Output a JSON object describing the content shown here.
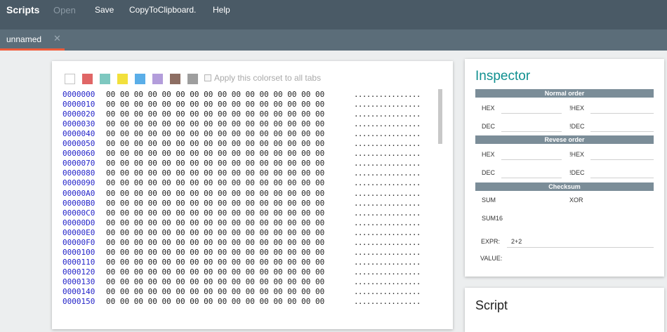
{
  "topbar": {
    "brand": "Scripts",
    "menu": {
      "open": "Open",
      "save": "Save",
      "copy": "CopyToClipboard.",
      "help": "Help"
    }
  },
  "tabs": [
    {
      "label": "unnamed",
      "close_glyph": "✕"
    }
  ],
  "colorset": {
    "swatches": [
      "#ffffff",
      "#e06666",
      "#7ec8c0",
      "#f2e03c",
      "#5aaee8",
      "#b39ddb",
      "#8d6e63",
      "#9e9e9e"
    ],
    "apply_label": "Apply this colorset to all tabs",
    "apply_checked": false
  },
  "hex": {
    "rows": [
      {
        "addr": "0000000",
        "bytes": "00 00 00 00 00 00 00 00 00 00 00 00 00 00 00 00",
        "ascii": "................"
      },
      {
        "addr": "0000010",
        "bytes": "00 00 00 00 00 00 00 00 00 00 00 00 00 00 00 00",
        "ascii": "................"
      },
      {
        "addr": "0000020",
        "bytes": "00 00 00 00 00 00 00 00 00 00 00 00 00 00 00 00",
        "ascii": "................"
      },
      {
        "addr": "0000030",
        "bytes": "00 00 00 00 00 00 00 00 00 00 00 00 00 00 00 00",
        "ascii": "................"
      },
      {
        "addr": "0000040",
        "bytes": "00 00 00 00 00 00 00 00 00 00 00 00 00 00 00 00",
        "ascii": "................"
      },
      {
        "addr": "0000050",
        "bytes": "00 00 00 00 00 00 00 00 00 00 00 00 00 00 00 00",
        "ascii": "................"
      },
      {
        "addr": "0000060",
        "bytes": "00 00 00 00 00 00 00 00 00 00 00 00 00 00 00 00",
        "ascii": "................"
      },
      {
        "addr": "0000070",
        "bytes": "00 00 00 00 00 00 00 00 00 00 00 00 00 00 00 00",
        "ascii": "................"
      },
      {
        "addr": "0000080",
        "bytes": "00 00 00 00 00 00 00 00 00 00 00 00 00 00 00 00",
        "ascii": "................"
      },
      {
        "addr": "0000090",
        "bytes": "00 00 00 00 00 00 00 00 00 00 00 00 00 00 00 00",
        "ascii": "................"
      },
      {
        "addr": "00000A0",
        "bytes": "00 00 00 00 00 00 00 00 00 00 00 00 00 00 00 00",
        "ascii": "................"
      },
      {
        "addr": "00000B0",
        "bytes": "00 00 00 00 00 00 00 00 00 00 00 00 00 00 00 00",
        "ascii": "................"
      },
      {
        "addr": "00000C0",
        "bytes": "00 00 00 00 00 00 00 00 00 00 00 00 00 00 00 00",
        "ascii": "................"
      },
      {
        "addr": "00000D0",
        "bytes": "00 00 00 00 00 00 00 00 00 00 00 00 00 00 00 00",
        "ascii": "................"
      },
      {
        "addr": "00000E0",
        "bytes": "00 00 00 00 00 00 00 00 00 00 00 00 00 00 00 00",
        "ascii": "................"
      },
      {
        "addr": "00000F0",
        "bytes": "00 00 00 00 00 00 00 00 00 00 00 00 00 00 00 00",
        "ascii": "................"
      },
      {
        "addr": "0000100",
        "bytes": "00 00 00 00 00 00 00 00 00 00 00 00 00 00 00 00",
        "ascii": "................"
      },
      {
        "addr": "0000110",
        "bytes": "00 00 00 00 00 00 00 00 00 00 00 00 00 00 00 00",
        "ascii": "................"
      },
      {
        "addr": "0000120",
        "bytes": "00 00 00 00 00 00 00 00 00 00 00 00 00 00 00 00",
        "ascii": "................"
      },
      {
        "addr": "0000130",
        "bytes": "00 00 00 00 00 00 00 00 00 00 00 00 00 00 00 00",
        "ascii": "................"
      },
      {
        "addr": "0000140",
        "bytes": "00 00 00 00 00 00 00 00 00 00 00 00 00 00 00 00",
        "ascii": "................"
      },
      {
        "addr": "0000150",
        "bytes": "00 00 00 00 00 00 00 00 00 00 00 00 00 00 00 00",
        "ascii": "................"
      }
    ]
  },
  "inspector": {
    "title": "Inspector",
    "normal_order": {
      "heading": "Normal order",
      "hex": "HEX",
      "not_hex": "!HEX",
      "dec": "DEC",
      "not_dec": "!DEC"
    },
    "reverse_order": {
      "heading": "Revese order",
      "hex": "HEX",
      "not_hex": "!HEX",
      "dec": "DEC",
      "not_dec": "!DEC"
    },
    "checksum": {
      "heading": "Checksum",
      "sum": "SUM",
      "xor": "XOR",
      "sum16": "SUM16"
    },
    "expr": {
      "label": "EXPR:",
      "value": "2+2"
    },
    "value": {
      "label": "VALUE:"
    }
  },
  "script": {
    "title": "Script"
  }
}
